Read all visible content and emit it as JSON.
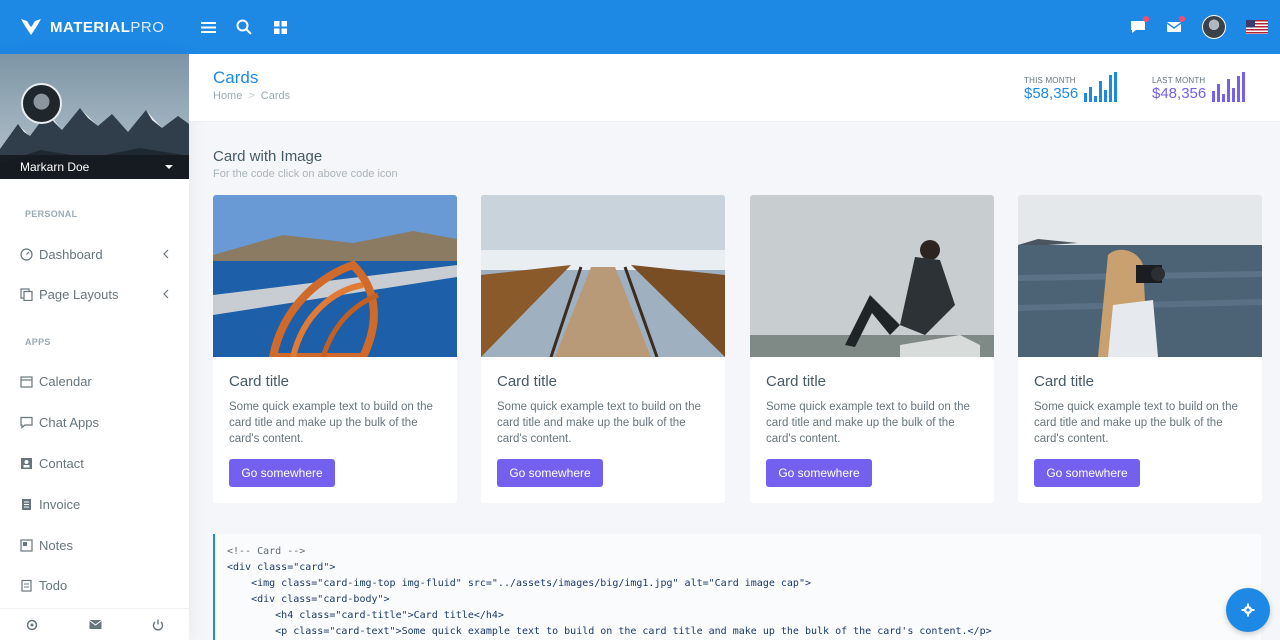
{
  "brand": {
    "name_bold": "MATERIAL",
    "name_light": "PRO"
  },
  "user": {
    "name": "Markarn Doe"
  },
  "header": {
    "title": "Cards",
    "breadcrumb": [
      "Home",
      "Cards"
    ],
    "stats": [
      {
        "label": "THIS MONTH",
        "value": "$58,356",
        "color": "#1e88e5",
        "bars": [
          0.3,
          0.5,
          0.2,
          0.7,
          0.4,
          0.9,
          1.0
        ]
      },
      {
        "label": "LAST MONTH",
        "value": "$48,356",
        "color": "#7460ee",
        "bars": [
          0.35,
          0.6,
          0.25,
          0.75,
          0.45,
          0.85,
          1.0
        ]
      }
    ]
  },
  "sidebar": {
    "sections": [
      {
        "label": "PERSONAL",
        "items": [
          {
            "label": "Dashboard",
            "icon": "gauge-icon",
            "has_arrow": true
          },
          {
            "label": "Page Layouts",
            "icon": "copy-icon",
            "has_arrow": true
          }
        ]
      },
      {
        "label": "APPS",
        "items": [
          {
            "label": "Calendar",
            "icon": "calendar-icon"
          },
          {
            "label": "Chat Apps",
            "icon": "chat-icon"
          },
          {
            "label": "Contact",
            "icon": "contact-icon"
          },
          {
            "label": "Invoice",
            "icon": "invoice-icon"
          },
          {
            "label": "Notes",
            "icon": "notes-icon"
          },
          {
            "label": "Todo",
            "icon": "todo-icon"
          }
        ]
      }
    ]
  },
  "content": {
    "title": "Card with Image",
    "subtitle": "For the code click on above code icon",
    "cards": [
      {
        "title": "Card title",
        "text": "Some quick example text to build on the card title and make up the bulk of the card's content.",
        "button": "Go somewhere",
        "image": "boat-rope-image"
      },
      {
        "title": "Card title",
        "text": "Some quick example text to build on the card title and make up the bulk of the card's content.",
        "button": "Go somewhere",
        "image": "boardwalk-image"
      },
      {
        "title": "Card title",
        "text": "Some quick example text to build on the card title and make up the bulk of the card's content.",
        "button": "Go somewhere",
        "image": "woman-sitting-image"
      },
      {
        "title": "Card title",
        "text": "Some quick example text to build on the card title and make up the bulk of the card's content.",
        "button": "Go somewhere",
        "image": "photographer-image"
      }
    ],
    "code_lines": [
      "<!-- Card -->",
      "<div class=\"card\">",
      "    <img class=\"card-img-top img-fluid\" src=\"../assets/images/big/img1.jpg\" alt=\"Card image cap\">",
      "    <div class=\"card-body\">",
      "        <h4 class=\"card-title\">Card title</h4>",
      "        <p class=\"card-text\">Some quick example text to build on the card title and make up the bulk of the card's content.</p>"
    ]
  },
  "colors": {
    "primary": "#1e88e5",
    "accent": "#7460ee",
    "sidebar_text": "#67757c"
  }
}
